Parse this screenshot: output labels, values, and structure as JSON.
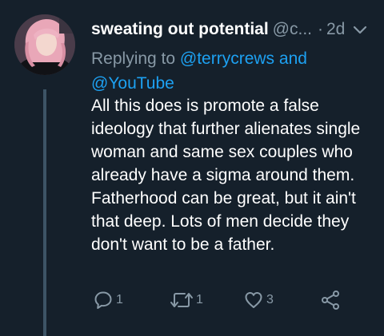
{
  "tweet": {
    "display_name": "sweating out potential",
    "handle": "@c...",
    "separator": "·",
    "time": "2d",
    "replying_prefix": "Replying to",
    "replying_mention_1": "@terrycrews",
    "replying_conjunction": "and",
    "replying_mention_2": "@YouTube",
    "text": "All this does is promote a false ideology that further alienates single woman and same sex couples who already have a sigma around them. Fatherhood can be great, but it ain't that deep. Lots of men decide they don't want to be a father."
  },
  "actions": {
    "reply_count": "1",
    "retweet_count": "1",
    "like_count": "3"
  },
  "icons": {
    "avatar": "avatar-photo",
    "caret": "chevron-down-icon",
    "reply": "speech-bubble-icon",
    "retweet": "retweet-icon",
    "like": "heart-icon",
    "share": "share-icon"
  },
  "colors": {
    "background": "#15202b",
    "text": "#ffffff",
    "secondary_text": "#8899a6",
    "link": "#1da1f2",
    "thread_line": "#3d5466"
  }
}
